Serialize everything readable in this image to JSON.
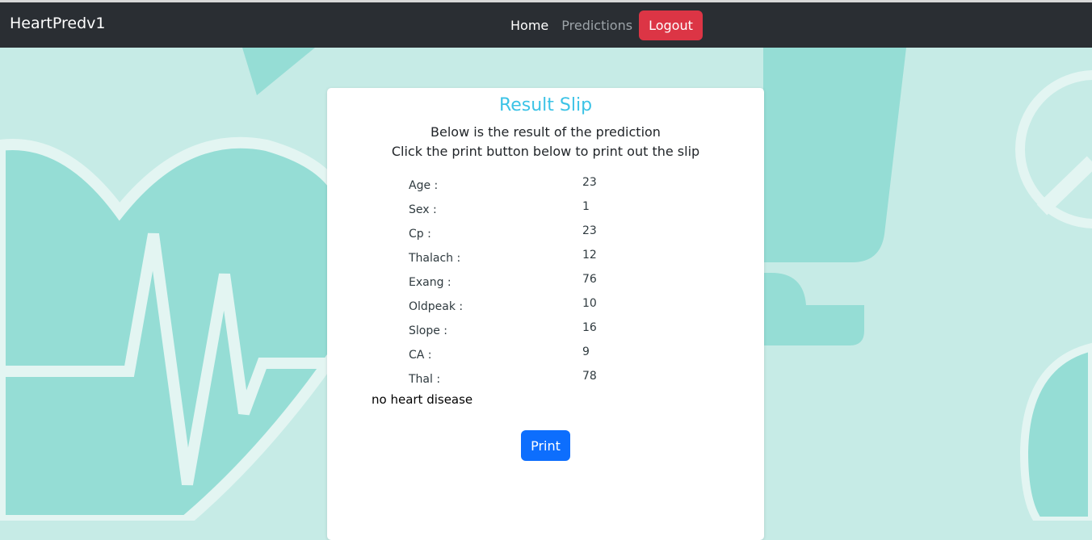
{
  "navbar": {
    "brand": "HeartPredv1",
    "links": {
      "home": "Home",
      "predictions": "Predictions"
    },
    "logout_label": "Logout"
  },
  "slip": {
    "title": "Result Slip",
    "line1": "Below is the result of the prediction",
    "line2": "Click the print button below to print out the slip",
    "fields": [
      {
        "label": "Age :",
        "value": "23"
      },
      {
        "label": "Sex :",
        "value": "1"
      },
      {
        "label": "Cp :",
        "value": "23"
      },
      {
        "label": "Thalach :",
        "value": "12"
      },
      {
        "label": "Exang :",
        "value": "76"
      },
      {
        "label": "Oldpeak :",
        "value": "10"
      },
      {
        "label": "Slope :",
        "value": "16"
      },
      {
        "label": "CA :",
        "value": "9"
      },
      {
        "label": "Thal :",
        "value": "78"
      }
    ],
    "result": "no heart disease",
    "print_label": "Print"
  },
  "colors": {
    "navbar": "#2a2e33",
    "background": "#c6ebe6",
    "accent_shape": "#95ddd5",
    "title": "#3cc3e6",
    "logout": "#dc3545",
    "print": "#0d6efd"
  }
}
